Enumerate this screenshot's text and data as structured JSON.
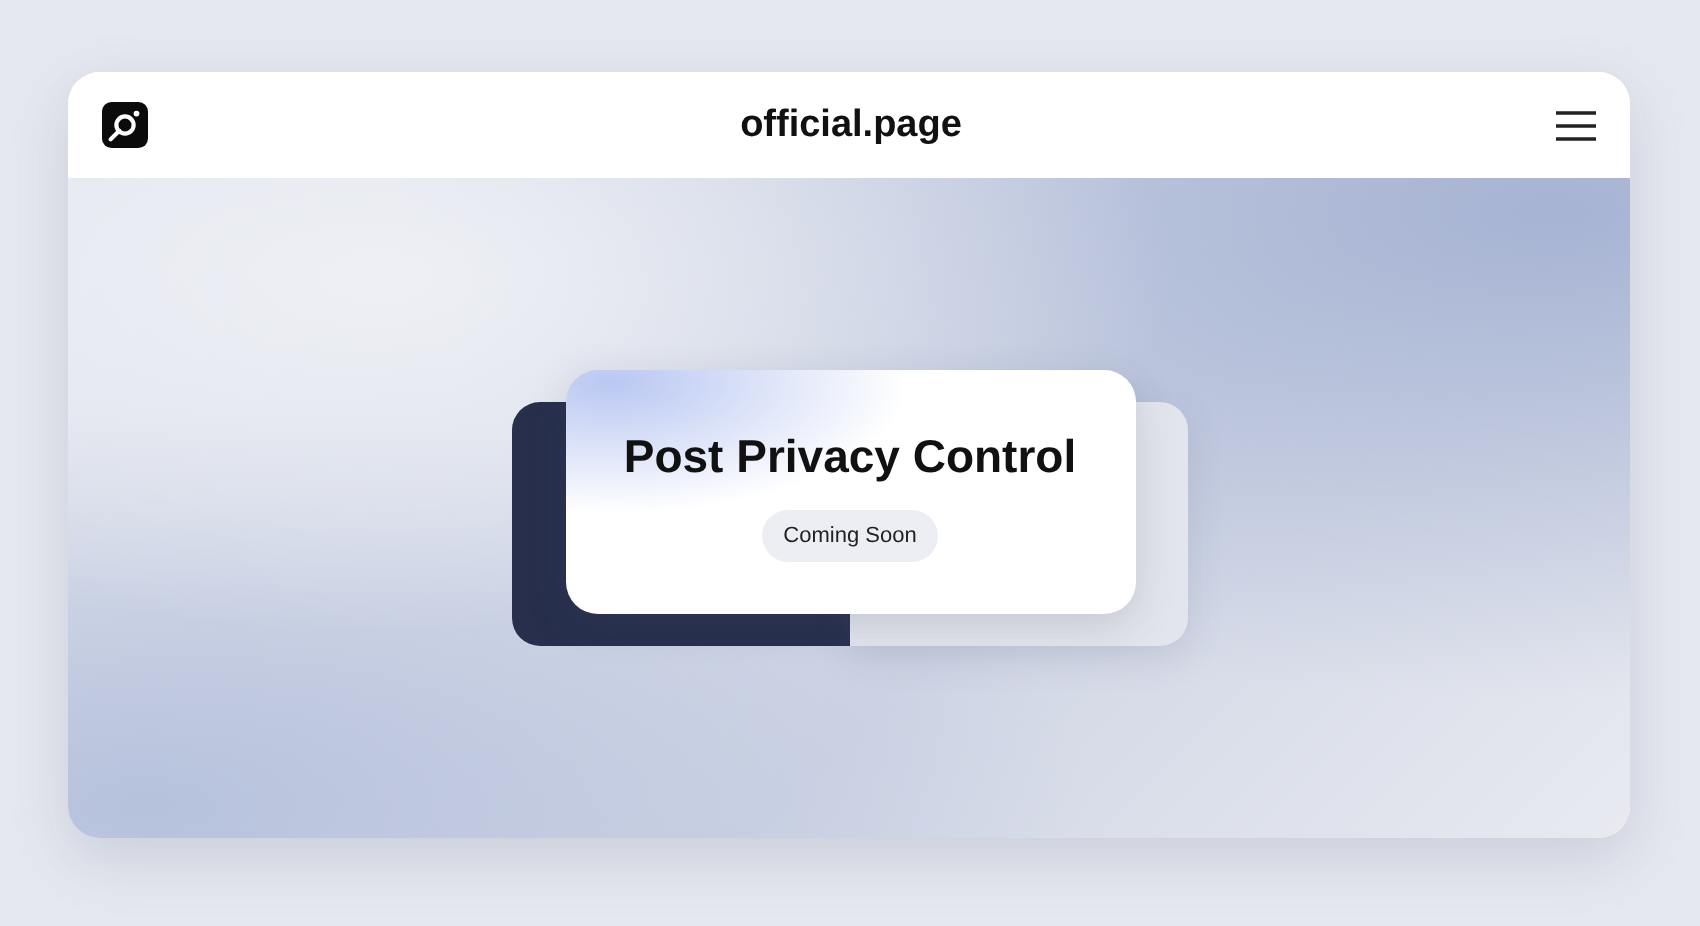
{
  "header": {
    "title": "official.page"
  },
  "card": {
    "title": "Post Privacy Control",
    "badge": "Coming Soon"
  }
}
